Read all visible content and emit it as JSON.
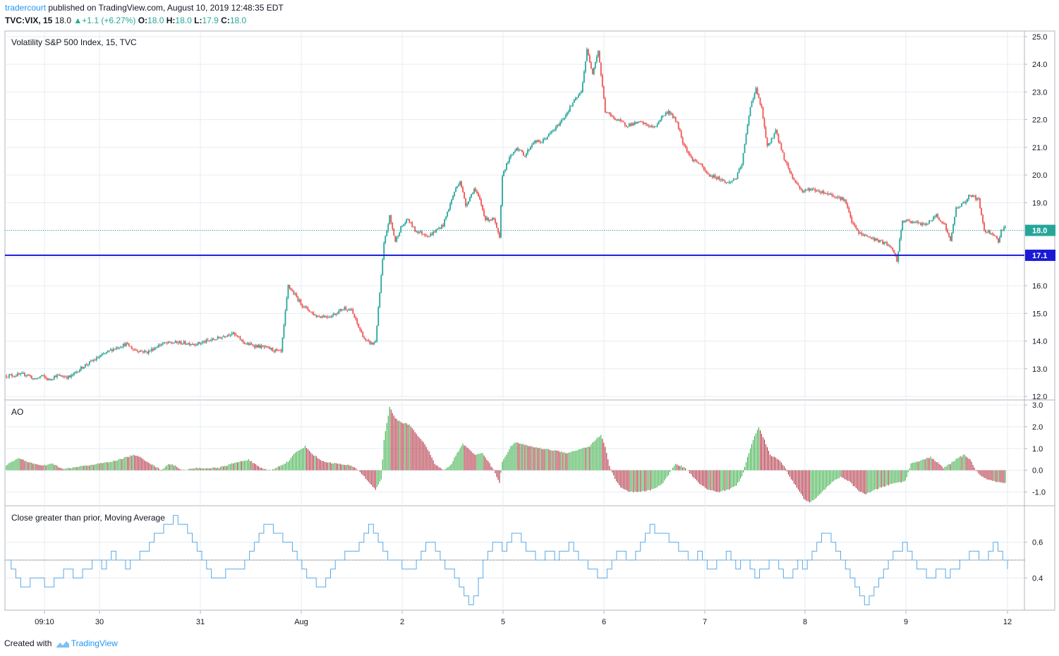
{
  "header": {
    "user": "tradercourt",
    "published_text": " published on TradingView.com, August 10, 2019 12:48:35 EDT",
    "symbol": "TVC:VIX, 15",
    "last": "18.0",
    "change": "+1.1 (+6.27%)",
    "o_label": "O:",
    "o_value": "18.0",
    "h_label": "H:",
    "h_value": "18.0",
    "l_label": "L:",
    "l_value": "17.9",
    "c_label": "C:",
    "c_value": "18.0"
  },
  "footer": {
    "created_with": "Created with",
    "brand": "TradingView"
  },
  "colors": {
    "up": "#26a69a",
    "down": "#ef5350",
    "hline": "#1a1ad6",
    "line": "#5aa9e6",
    "grid": "#e6ecf2"
  },
  "chart_data": [
    {
      "type": "candlestick",
      "title": "Volatility S&P 500 Index, 15, TVC",
      "y_ticks": [
        "12.0",
        "13.0",
        "14.0",
        "15.0",
        "16.0",
        "17.0",
        "18.0",
        "19.0",
        "20.0",
        "21.0",
        "22.0",
        "23.0",
        "24.0",
        "25.0"
      ],
      "ylim": [
        11.9,
        25.2
      ],
      "last_price_label": "18.0",
      "horizontal_line": {
        "value": 17.1,
        "label": "17.1"
      },
      "x_labels": [
        "09:10",
        "30",
        "31",
        "Aug",
        "2",
        "5",
        "6",
        "7",
        "8",
        "9",
        "12"
      ],
      "anchors": [
        [
          0,
          12.75
        ],
        [
          15,
          12.8
        ],
        [
          20,
          12.6
        ],
        [
          25,
          12.75
        ],
        [
          30,
          12.6
        ],
        [
          35,
          12.75
        ],
        [
          45,
          12.7
        ],
        [
          55,
          13.1
        ],
        [
          65,
          13.4
        ],
        [
          75,
          13.7
        ],
        [
          85,
          13.9
        ],
        [
          90,
          13.7
        ],
        [
          100,
          13.6
        ],
        [
          110,
          13.9
        ],
        [
          120,
          13.95
        ],
        [
          135,
          13.9
        ],
        [
          150,
          14.1
        ],
        [
          160,
          14.3
        ],
        [
          170,
          13.9
        ],
        [
          185,
          13.75
        ],
        [
          195,
          13.6
        ],
        [
          200,
          16.0
        ],
        [
          210,
          15.3
        ],
        [
          220,
          14.9
        ],
        [
          230,
          14.9
        ],
        [
          240,
          15.2
        ],
        [
          245,
          15.1
        ],
        [
          250,
          14.5
        ],
        [
          255,
          14.0
        ],
        [
          260,
          13.9
        ],
        [
          262,
          14.0
        ],
        [
          268,
          17.5
        ],
        [
          272,
          18.5
        ],
        [
          276,
          17.6
        ],
        [
          280,
          18.1
        ],
        [
          285,
          18.4
        ],
        [
          290,
          18.0
        ],
        [
          300,
          17.8
        ],
        [
          310,
          18.2
        ],
        [
          318,
          19.4
        ],
        [
          322,
          19.8
        ],
        [
          326,
          18.9
        ],
        [
          332,
          19.5
        ],
        [
          336,
          19.1
        ],
        [
          340,
          18.4
        ],
        [
          346,
          18.4
        ],
        [
          350,
          17.7
        ],
        [
          352,
          20.0
        ],
        [
          356,
          20.5
        ],
        [
          362,
          21.0
        ],
        [
          368,
          20.7
        ],
        [
          374,
          21.2
        ],
        [
          380,
          21.2
        ],
        [
          390,
          21.7
        ],
        [
          396,
          22.1
        ],
        [
          402,
          22.6
        ],
        [
          408,
          23.0
        ],
        [
          412,
          24.5
        ],
        [
          416,
          23.7
        ],
        [
          420,
          24.5
        ],
        [
          425,
          22.3
        ],
        [
          430,
          22.1
        ],
        [
          440,
          21.8
        ],
        [
          450,
          21.9
        ],
        [
          460,
          21.7
        ],
        [
          465,
          22.1
        ],
        [
          470,
          22.3
        ],
        [
          476,
          21.9
        ],
        [
          480,
          21.2
        ],
        [
          486,
          20.6
        ],
        [
          492,
          20.4
        ],
        [
          498,
          20.0
        ],
        [
          505,
          19.9
        ],
        [
          512,
          19.7
        ],
        [
          518,
          19.9
        ],
        [
          522,
          20.4
        ],
        [
          528,
          22.5
        ],
        [
          532,
          23.1
        ],
        [
          536,
          22.4
        ],
        [
          540,
          21.0
        ],
        [
          546,
          21.6
        ],
        [
          552,
          20.6
        ],
        [
          558,
          19.9
        ],
        [
          565,
          19.4
        ],
        [
          570,
          19.5
        ],
        [
          578,
          19.4
        ],
        [
          585,
          19.3
        ],
        [
          595,
          19.1
        ],
        [
          600,
          18.3
        ],
        [
          605,
          17.9
        ],
        [
          615,
          17.7
        ],
        [
          625,
          17.5
        ],
        [
          630,
          17.2
        ],
        [
          632,
          16.9
        ],
        [
          636,
          18.35
        ],
        [
          645,
          18.3
        ],
        [
          650,
          18.2
        ],
        [
          655,
          18.3
        ],
        [
          660,
          18.55
        ],
        [
          666,
          18.2
        ],
        [
          670,
          17.6
        ],
        [
          674,
          18.8
        ],
        [
          680,
          19.0
        ],
        [
          684,
          19.3
        ],
        [
          690,
          19.1
        ],
        [
          694,
          18.0
        ],
        [
          700,
          17.9
        ],
        [
          704,
          17.6
        ],
        [
          706,
          18.0
        ],
        [
          708,
          18.1
        ]
      ]
    },
    {
      "type": "histogram",
      "title": "AO",
      "y_ticks": [
        "3.0",
        "2.0",
        "1.0",
        "0.0",
        "-1.0"
      ],
      "ylim": [
        -1.6,
        3.2
      ],
      "anchors": [
        [
          0,
          0.25
        ],
        [
          8,
          0.55
        ],
        [
          15,
          0.4
        ],
        [
          25,
          0.2
        ],
        [
          33,
          0.3
        ],
        [
          40,
          0.05
        ],
        [
          45,
          0.1
        ],
        [
          55,
          0.2
        ],
        [
          65,
          0.3
        ],
        [
          75,
          0.4
        ],
        [
          90,
          0.7
        ],
        [
          95,
          0.6
        ],
        [
          105,
          0.2
        ],
        [
          110,
          0.0
        ],
        [
          115,
          0.3
        ],
        [
          120,
          0.2
        ],
        [
          125,
          0.0
        ],
        [
          135,
          0.1
        ],
        [
          150,
          0.1
        ],
        [
          160,
          0.3
        ],
        [
          172,
          0.5
        ],
        [
          180,
          0.1
        ],
        [
          188,
          0.0
        ],
        [
          200,
          0.4
        ],
        [
          205,
          0.8
        ],
        [
          212,
          1.1
        ],
        [
          218,
          0.7
        ],
        [
          225,
          0.4
        ],
        [
          235,
          0.3
        ],
        [
          245,
          0.2
        ],
        [
          250,
          0.0
        ],
        [
          258,
          -0.6
        ],
        [
          262,
          -0.9
        ],
        [
          266,
          -0.4
        ],
        [
          268,
          1.4
        ],
        [
          272,
          2.9
        ],
        [
          276,
          2.4
        ],
        [
          280,
          2.2
        ],
        [
          286,
          2.1
        ],
        [
          292,
          1.6
        ],
        [
          298,
          1.1
        ],
        [
          304,
          0.3
        ],
        [
          310,
          0.0
        ],
        [
          315,
          0.2
        ],
        [
          320,
          0.8
        ],
        [
          324,
          1.2
        ],
        [
          328,
          1.0
        ],
        [
          333,
          0.7
        ],
        [
          338,
          0.8
        ],
        [
          342,
          0.4
        ],
        [
          346,
          0.0
        ],
        [
          350,
          -0.6
        ],
        [
          352,
          0.4
        ],
        [
          358,
          1.1
        ],
        [
          362,
          1.3
        ],
        [
          366,
          1.2
        ],
        [
          372,
          1.1
        ],
        [
          380,
          1.0
        ],
        [
          390,
          0.9
        ],
        [
          398,
          0.8
        ],
        [
          404,
          0.9
        ],
        [
          408,
          1.0
        ],
        [
          414,
          1.1
        ],
        [
          418,
          1.4
        ],
        [
          422,
          1.6
        ],
        [
          425,
          1.1
        ],
        [
          428,
          0.2
        ],
        [
          432,
          -0.4
        ],
        [
          436,
          -0.8
        ],
        [
          442,
          -1.0
        ],
        [
          450,
          -1.0
        ],
        [
          458,
          -0.9
        ],
        [
          466,
          -0.6
        ],
        [
          470,
          -0.2
        ],
        [
          475,
          0.3
        ],
        [
          482,
          0.1
        ],
        [
          486,
          -0.2
        ],
        [
          492,
          -0.6
        ],
        [
          498,
          -0.9
        ],
        [
          505,
          -1.0
        ],
        [
          512,
          -0.9
        ],
        [
          518,
          -0.7
        ],
        [
          522,
          -0.3
        ],
        [
          526,
          0.6
        ],
        [
          530,
          1.4
        ],
        [
          534,
          2.0
        ],
        [
          538,
          1.4
        ],
        [
          542,
          0.7
        ],
        [
          548,
          0.5
        ],
        [
          552,
          0.2
        ],
        [
          556,
          -0.3
        ],
        [
          562,
          -0.9
        ],
        [
          566,
          -1.3
        ],
        [
          570,
          -1.5
        ],
        [
          576,
          -1.2
        ],
        [
          585,
          -0.6
        ],
        [
          592,
          -0.3
        ],
        [
          598,
          -0.5
        ],
        [
          604,
          -0.9
        ],
        [
          610,
          -1.1
        ],
        [
          620,
          -0.8
        ],
        [
          630,
          -0.6
        ],
        [
          638,
          -0.5
        ],
        [
          642,
          0.3
        ],
        [
          646,
          0.4
        ],
        [
          656,
          0.6
        ],
        [
          660,
          0.4
        ],
        [
          665,
          0.1
        ],
        [
          670,
          0.3
        ],
        [
          676,
          0.6
        ],
        [
          680,
          0.7
        ],
        [
          684,
          0.5
        ],
        [
          688,
          0.0
        ],
        [
          692,
          -0.3
        ],
        [
          700,
          -0.5
        ],
        [
          708,
          -0.6
        ]
      ]
    },
    {
      "type": "line",
      "title": "Close greater than prior, Moving Average",
      "y_ticks": [
        "0.6",
        "0.4"
      ],
      "ylim": [
        0.22,
        0.8
      ],
      "reference_line": 0.5,
      "values": [
        0.5,
        0.45,
        0.4,
        0.35,
        0.35,
        0.4,
        0.4,
        0.4,
        0.35,
        0.35,
        0.4,
        0.4,
        0.45,
        0.45,
        0.4,
        0.4,
        0.45,
        0.45,
        0.5,
        0.5,
        0.45,
        0.5,
        0.55,
        0.5,
        0.5,
        0.45,
        0.5,
        0.5,
        0.55,
        0.55,
        0.6,
        0.65,
        0.65,
        0.7,
        0.7,
        0.75,
        0.7,
        0.7,
        0.65,
        0.6,
        0.55,
        0.5,
        0.45,
        0.4,
        0.4,
        0.4,
        0.45,
        0.45,
        0.45,
        0.45,
        0.5,
        0.55,
        0.6,
        0.65,
        0.7,
        0.7,
        0.65,
        0.65,
        0.6,
        0.6,
        0.55,
        0.5,
        0.45,
        0.4,
        0.4,
        0.35,
        0.35,
        0.4,
        0.45,
        0.5,
        0.5,
        0.55,
        0.55,
        0.55,
        0.6,
        0.65,
        0.7,
        0.65,
        0.6,
        0.55,
        0.5,
        0.5,
        0.5,
        0.45,
        0.45,
        0.45,
        0.5,
        0.55,
        0.6,
        0.6,
        0.55,
        0.5,
        0.45,
        0.45,
        0.4,
        0.35,
        0.3,
        0.25,
        0.3,
        0.4,
        0.5,
        0.55,
        0.6,
        0.6,
        0.55,
        0.6,
        0.65,
        0.65,
        0.6,
        0.55,
        0.55,
        0.5,
        0.5,
        0.55,
        0.55,
        0.5,
        0.55,
        0.55,
        0.6,
        0.55,
        0.5,
        0.5,
        0.45,
        0.45,
        0.4,
        0.4,
        0.45,
        0.5,
        0.55,
        0.55,
        0.5,
        0.5,
        0.55,
        0.6,
        0.65,
        0.7,
        0.65,
        0.65,
        0.65,
        0.6,
        0.6,
        0.55,
        0.55,
        0.5,
        0.5,
        0.55,
        0.5,
        0.45,
        0.45,
        0.5,
        0.5,
        0.55,
        0.5,
        0.45,
        0.5,
        0.5,
        0.45,
        0.4,
        0.45,
        0.45,
        0.5,
        0.5,
        0.45,
        0.4,
        0.4,
        0.45,
        0.5,
        0.45,
        0.5,
        0.55,
        0.6,
        0.65,
        0.65,
        0.6,
        0.55,
        0.5,
        0.45,
        0.4,
        0.35,
        0.3,
        0.25,
        0.3,
        0.35,
        0.4,
        0.45,
        0.5,
        0.55,
        0.55,
        0.6,
        0.55,
        0.5,
        0.45,
        0.45,
        0.4,
        0.4,
        0.45,
        0.45,
        0.4,
        0.45,
        0.45,
        0.5,
        0.5,
        0.55,
        0.55,
        0.5,
        0.5,
        0.55,
        0.6,
        0.55,
        0.5,
        0.45
      ]
    }
  ]
}
